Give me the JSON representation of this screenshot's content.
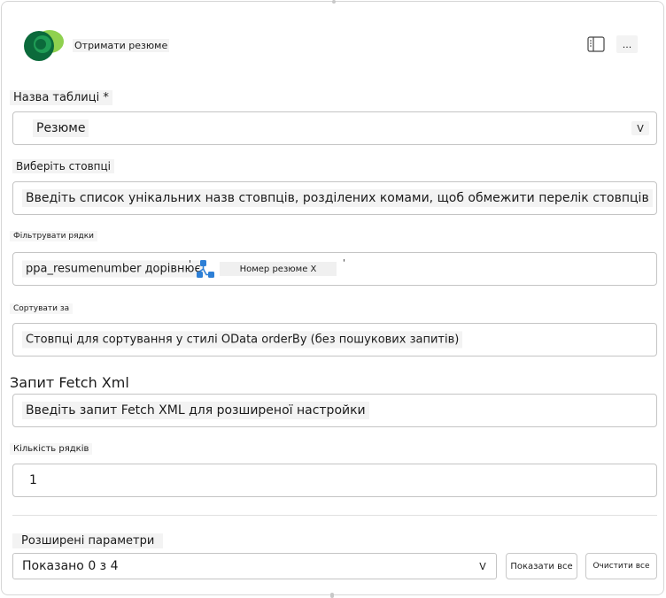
{
  "header": {
    "title": "Отримати резюме",
    "more_label": "..."
  },
  "table_name": {
    "label": "Назва таблиці *",
    "value": "Резюме",
    "chevron": "V"
  },
  "select_columns": {
    "label": "Виберіть стовпці",
    "placeholder": "Введіть список унікальних назв стовпців, розділених комами, щоб обмежити перелік стовпців"
  },
  "filter_rows": {
    "label": "Фільтрувати рядки",
    "expression": "ppa_resumenumber дорівнює",
    "quote_open": "'",
    "token_label": "Номер резюме X",
    "quote_close": "'"
  },
  "sort_by": {
    "label": "Сортувати за",
    "placeholder": "Стовпці для сортування у стилі OData orderBy (без пошукових запитів)"
  },
  "fetch_xml": {
    "label": "Запит Fetch Xml",
    "placeholder": "Введіть запит Fetch XML для розширеної настройки"
  },
  "row_count": {
    "label": "Кількість рядків",
    "value": "1"
  },
  "advanced": {
    "label": "Розширені параметри",
    "shown": "Показано 0 з 4",
    "chevron": "V",
    "show_all": "Показати все",
    "clear_all": "Очистити все"
  },
  "colors": {
    "logo_dark": "#0b6a3b",
    "logo_light": "#8fd14f",
    "token_icon": "#2d7fd6"
  }
}
